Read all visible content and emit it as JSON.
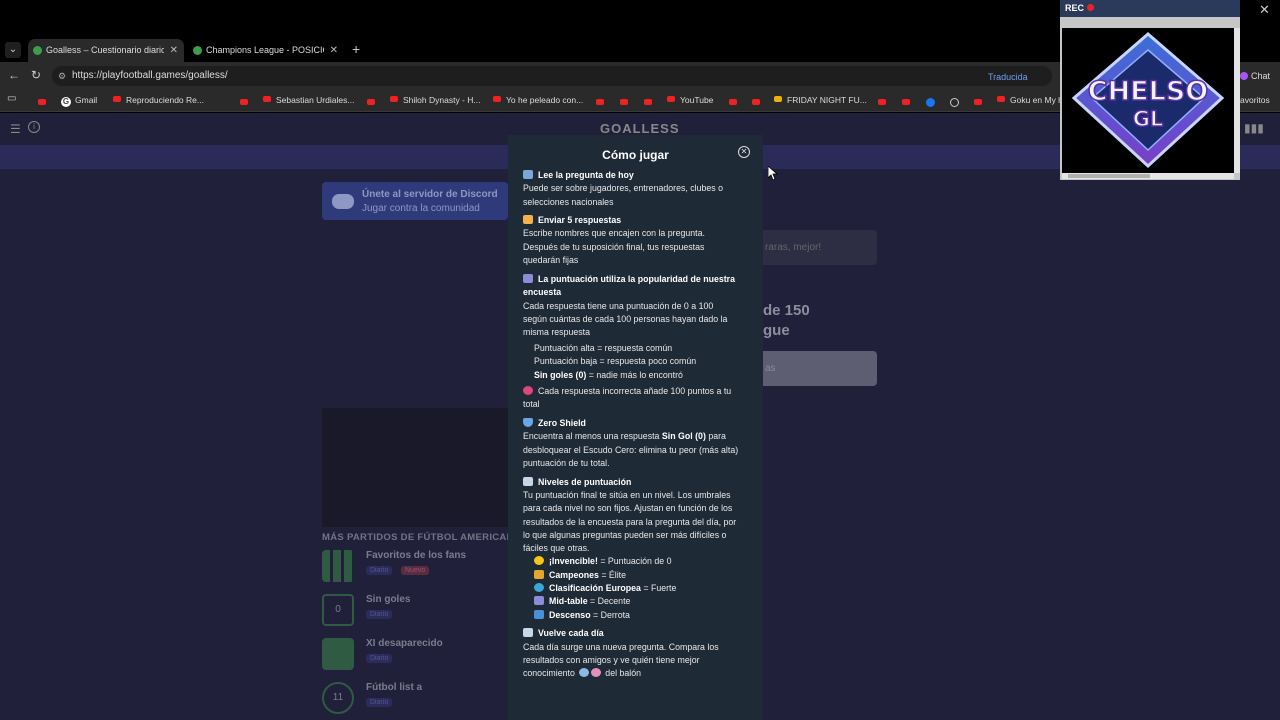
{
  "browser": {
    "tabs": [
      {
        "title": "Goalless – Cuestionario diario de f"
      },
      {
        "title": "Champions League - POSICIONES"
      }
    ],
    "url": "https://playfootball.games/goalless/",
    "translate_label": "Traducida",
    "chat_label": "Chat",
    "bookmarks": [
      "Gmail",
      "Reproduciendo Re...",
      "Sebastian Urdiales...",
      "Shiloh Dynasty - H...",
      "Yo he peleado con...",
      "YouTube",
      "FRIDAY NIGHT FU...",
      "Goku en My h"
    ],
    "bookmarks_overflow": "avoritos"
  },
  "site": {
    "logo": "GOALLESS",
    "discord_title": "Únete al servidor de Discord",
    "discord_sub": "Jugar contra la comunidad",
    "input_placeholder": "raras, mejor!",
    "headline_line1": "de 150",
    "headline_line2": "gue",
    "button_text": "as",
    "section_title": "MÁS PARTIDOS DE FÚTBOL AMERICANO",
    "games": [
      {
        "title": "Favoritos de los fans",
        "badge": "Diario",
        "badge2": "Nuevo"
      },
      {
        "title": "Sin goles",
        "badge": "Diario",
        "icon_text": "0"
      },
      {
        "title": "XI desaparecido",
        "badge": "Diario"
      },
      {
        "title": "Fútbol list a",
        "badge": "Diario",
        "icon_text": "11"
      }
    ]
  },
  "modal": {
    "title": "Cómo jugar",
    "l01": "Lee la pregunta de hoy",
    "l02": "Puede ser sobre jugadores, entrenadores, clubes o",
    "l03": "selecciones nacionales",
    "l04": "Enviar 5 respuestas",
    "l05": "Escribe nombres que encajen con la pregunta.",
    "l06": "Después de tu suposición final, tus respuestas",
    "l07": "quedarán fijas",
    "l08": "La puntuación utiliza la popularidad de nuestra",
    "l09": "encuesta",
    "l10": "Cada respuesta tiene una puntuación de 0 a 100",
    "l11": "según cuántas de cada 100 personas hayan dado la",
    "l12": "misma respuesta",
    "l13a": "Puntuación alta",
    "l13b": " = respuesta común",
    "l14a": "Puntuación baja",
    "l14b": " = respuesta poco común",
    "l15a": "Sin goles (0)",
    "l15b": " = nadie más lo encontró",
    "l16": "Cada respuesta incorrecta añade 100 puntos a tu",
    "l17": "total",
    "l18": "Zero Shield",
    "l19a": "Encuentra al menos una respuesta ",
    "l19b": "Sin Gol (0)",
    "l19c": " para",
    "l20": "desbloquear el Escudo Cero: elimina tu peor (más alta)",
    "l21": "puntuación de tu total.",
    "l22": "Niveles de puntuación",
    "l23": "Tu puntuación final te sitúa en un nivel. Los umbrales",
    "l24": "para cada nivel no son fijos. Ajustan en función de los",
    "l25": "resultados de la encuesta para la pregunta del día, por",
    "l26": "lo que algunas preguntas pueden ser más difíciles o",
    "l27": "fáciles que otras.",
    "l28a": "¡Invencible!",
    "l28b": " = Puntuación de 0",
    "l29a": "Campeones",
    "l29b": " = Élite",
    "l30a": "Clasificación Europea",
    "l30b": " = Fuerte",
    "l31a": "Mid-table",
    "l31b": " = Decente",
    "l32a": "Descenso",
    "l32b": " = Derrota",
    "l33": "Vuelve cada día",
    "l34": "Cada día surge una nueva pregunta. Compara los",
    "l35": "resultados con amigos y ve quién tiene mejor",
    "l36": "conocimiento",
    "l36b": "del balón"
  },
  "overlay": {
    "rec_label": "REC",
    "logo_line1": "CHELSO",
    "logo_line2": "GL"
  }
}
